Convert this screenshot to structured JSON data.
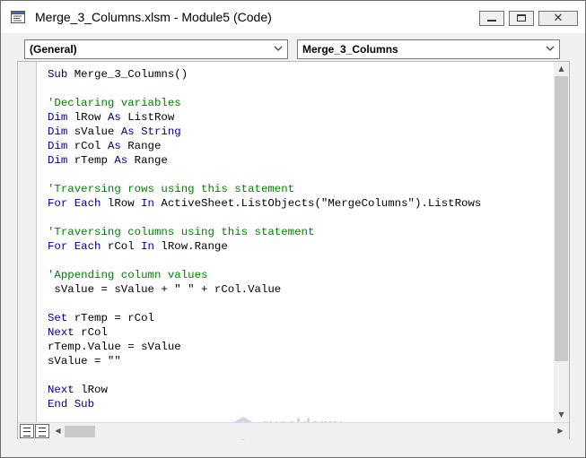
{
  "window": {
    "title": "Merge_3_Columns.xlsm - Module5 (Code)",
    "close_glyph": "✕"
  },
  "combos": {
    "object": "(General)",
    "procedure": "Merge_3_Columns"
  },
  "code_lines": [
    [
      {
        "t": "Sub Merge_3_Columns()",
        "c": "kw-mixed"
      }
    ],
    [],
    [
      {
        "t": "'Declaring variables",
        "c": "cm"
      }
    ],
    [
      {
        "t": "Dim",
        "c": "kw"
      },
      {
        "t": " lRow ",
        "c": ""
      },
      {
        "t": "As",
        "c": "kw"
      },
      {
        "t": " ListRow",
        "c": ""
      }
    ],
    [
      {
        "t": "Dim",
        "c": "kw"
      },
      {
        "t": " sValue ",
        "c": ""
      },
      {
        "t": "As String",
        "c": "kw"
      }
    ],
    [
      {
        "t": "Dim",
        "c": "kw"
      },
      {
        "t": " rCol ",
        "c": ""
      },
      {
        "t": "As",
        "c": "kw"
      },
      {
        "t": " Range",
        "c": ""
      }
    ],
    [
      {
        "t": "Dim",
        "c": "kw"
      },
      {
        "t": " rTemp ",
        "c": ""
      },
      {
        "t": "As",
        "c": "kw"
      },
      {
        "t": " Range",
        "c": ""
      }
    ],
    [],
    [
      {
        "t": "'Traversing rows using this statement",
        "c": "cm"
      }
    ],
    [
      {
        "t": "For Each",
        "c": "kw"
      },
      {
        "t": " lRow ",
        "c": ""
      },
      {
        "t": "In",
        "c": "kw"
      },
      {
        "t": " ActiveSheet.ListObjects(\"MergeColumns\").ListRows",
        "c": ""
      }
    ],
    [],
    [
      {
        "t": "'Traversing columns using this statement",
        "c": "cm"
      }
    ],
    [
      {
        "t": "For Each",
        "c": "kw"
      },
      {
        "t": " rCol ",
        "c": ""
      },
      {
        "t": "In",
        "c": "kw"
      },
      {
        "t": " lRow.Range",
        "c": ""
      }
    ],
    [],
    [
      {
        "t": "'Appending column values",
        "c": "cm"
      }
    ],
    [
      {
        "t": " sValue = sValue + \" \" + rCol.Value",
        "c": ""
      }
    ],
    [],
    [
      {
        "t": "Set",
        "c": "kw"
      },
      {
        "t": " rTemp = rCol",
        "c": ""
      }
    ],
    [
      {
        "t": "Next",
        "c": "kw"
      },
      {
        "t": " rCol",
        "c": ""
      }
    ],
    [
      {
        "t": "rTemp.Value = sValue",
        "c": ""
      }
    ],
    [
      {
        "t": "sValue = \"\"",
        "c": ""
      }
    ],
    [],
    [
      {
        "t": "Next",
        "c": "kw"
      },
      {
        "t": " lRow",
        "c": ""
      }
    ],
    [
      {
        "t": "End Sub",
        "c": "kw"
      }
    ]
  ],
  "watermark": {
    "name": "exceldemy",
    "tagline": "EXCEL · DATA · BI"
  },
  "colors": {
    "keyword": "#00008b",
    "comment": "#008000",
    "text": "#000000"
  }
}
